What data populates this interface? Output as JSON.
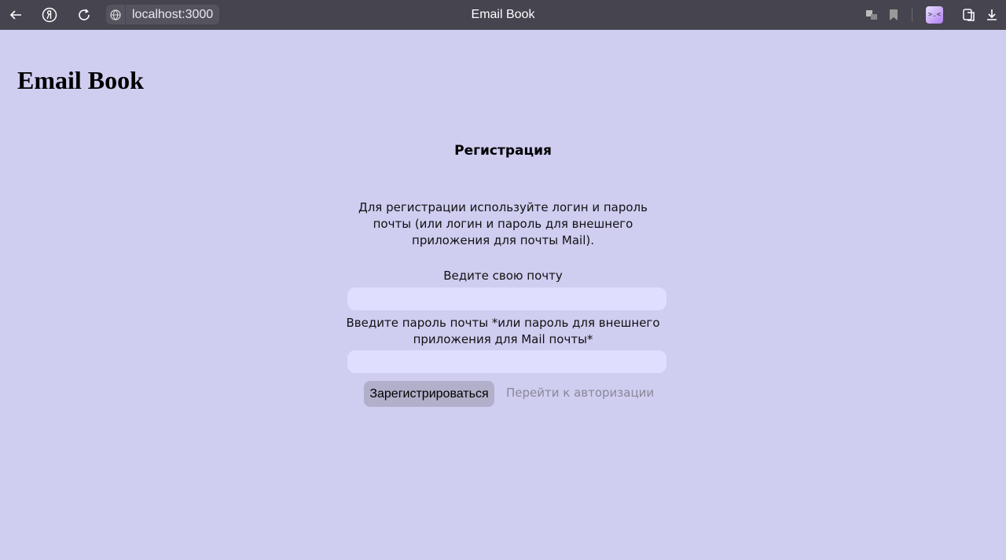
{
  "browser": {
    "url": "localhost:3000",
    "tab_title": "Email Book",
    "extension_glyph": ">.<",
    "icons": [
      "back-icon",
      "yandex-icon",
      "reload-icon",
      "globe-icon",
      "translate-icon",
      "bookmark-icon",
      "extension-icon",
      "collections-icon",
      "download-icon"
    ]
  },
  "page": {
    "logo": "Email Book",
    "title": "Регистрация",
    "description": "Для регистрации используйте логин и пароль почты (или логин и пароль для внешнего приложения для почты Mail).",
    "email_label": "Ведите свою почту",
    "email_value": "",
    "password_label": "Введите пароль почты *или пароль для внешнего приложения для Mail почты*",
    "password_value": "",
    "register_button": "Зарегистрироваться",
    "auth_link": "Перейти к авторизации"
  },
  "colors": {
    "background": "#cfcdf0",
    "input_bg": "#e0defe",
    "button_bg": "#b1afc9",
    "topbar_bg": "#45444f"
  }
}
